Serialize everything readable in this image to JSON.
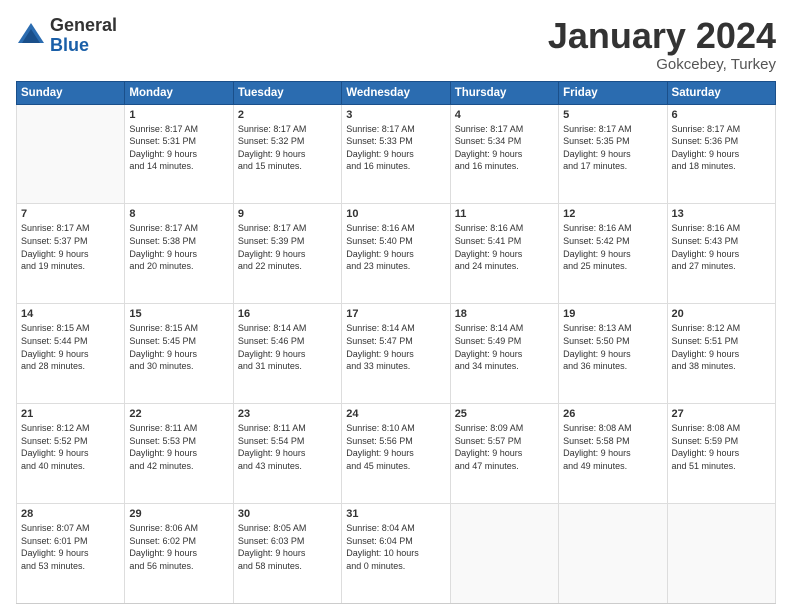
{
  "header": {
    "logo_general": "General",
    "logo_blue": "Blue",
    "month_title": "January 2024",
    "subtitle": "Gokcebey, Turkey"
  },
  "weekdays": [
    "Sunday",
    "Monday",
    "Tuesday",
    "Wednesday",
    "Thursday",
    "Friday",
    "Saturday"
  ],
  "weeks": [
    [
      {
        "day": "",
        "info": ""
      },
      {
        "day": "1",
        "info": "Sunrise: 8:17 AM\nSunset: 5:31 PM\nDaylight: 9 hours\nand 14 minutes."
      },
      {
        "day": "2",
        "info": "Sunrise: 8:17 AM\nSunset: 5:32 PM\nDaylight: 9 hours\nand 15 minutes."
      },
      {
        "day": "3",
        "info": "Sunrise: 8:17 AM\nSunset: 5:33 PM\nDaylight: 9 hours\nand 16 minutes."
      },
      {
        "day": "4",
        "info": "Sunrise: 8:17 AM\nSunset: 5:34 PM\nDaylight: 9 hours\nand 16 minutes."
      },
      {
        "day": "5",
        "info": "Sunrise: 8:17 AM\nSunset: 5:35 PM\nDaylight: 9 hours\nand 17 minutes."
      },
      {
        "day": "6",
        "info": "Sunrise: 8:17 AM\nSunset: 5:36 PM\nDaylight: 9 hours\nand 18 minutes."
      }
    ],
    [
      {
        "day": "7",
        "info": "Sunrise: 8:17 AM\nSunset: 5:37 PM\nDaylight: 9 hours\nand 19 minutes."
      },
      {
        "day": "8",
        "info": "Sunrise: 8:17 AM\nSunset: 5:38 PM\nDaylight: 9 hours\nand 20 minutes."
      },
      {
        "day": "9",
        "info": "Sunrise: 8:17 AM\nSunset: 5:39 PM\nDaylight: 9 hours\nand 22 minutes."
      },
      {
        "day": "10",
        "info": "Sunrise: 8:16 AM\nSunset: 5:40 PM\nDaylight: 9 hours\nand 23 minutes."
      },
      {
        "day": "11",
        "info": "Sunrise: 8:16 AM\nSunset: 5:41 PM\nDaylight: 9 hours\nand 24 minutes."
      },
      {
        "day": "12",
        "info": "Sunrise: 8:16 AM\nSunset: 5:42 PM\nDaylight: 9 hours\nand 25 minutes."
      },
      {
        "day": "13",
        "info": "Sunrise: 8:16 AM\nSunset: 5:43 PM\nDaylight: 9 hours\nand 27 minutes."
      }
    ],
    [
      {
        "day": "14",
        "info": "Sunrise: 8:15 AM\nSunset: 5:44 PM\nDaylight: 9 hours\nand 28 minutes."
      },
      {
        "day": "15",
        "info": "Sunrise: 8:15 AM\nSunset: 5:45 PM\nDaylight: 9 hours\nand 30 minutes."
      },
      {
        "day": "16",
        "info": "Sunrise: 8:14 AM\nSunset: 5:46 PM\nDaylight: 9 hours\nand 31 minutes."
      },
      {
        "day": "17",
        "info": "Sunrise: 8:14 AM\nSunset: 5:47 PM\nDaylight: 9 hours\nand 33 minutes."
      },
      {
        "day": "18",
        "info": "Sunrise: 8:14 AM\nSunset: 5:49 PM\nDaylight: 9 hours\nand 34 minutes."
      },
      {
        "day": "19",
        "info": "Sunrise: 8:13 AM\nSunset: 5:50 PM\nDaylight: 9 hours\nand 36 minutes."
      },
      {
        "day": "20",
        "info": "Sunrise: 8:12 AM\nSunset: 5:51 PM\nDaylight: 9 hours\nand 38 minutes."
      }
    ],
    [
      {
        "day": "21",
        "info": "Sunrise: 8:12 AM\nSunset: 5:52 PM\nDaylight: 9 hours\nand 40 minutes."
      },
      {
        "day": "22",
        "info": "Sunrise: 8:11 AM\nSunset: 5:53 PM\nDaylight: 9 hours\nand 42 minutes."
      },
      {
        "day": "23",
        "info": "Sunrise: 8:11 AM\nSunset: 5:54 PM\nDaylight: 9 hours\nand 43 minutes."
      },
      {
        "day": "24",
        "info": "Sunrise: 8:10 AM\nSunset: 5:56 PM\nDaylight: 9 hours\nand 45 minutes."
      },
      {
        "day": "25",
        "info": "Sunrise: 8:09 AM\nSunset: 5:57 PM\nDaylight: 9 hours\nand 47 minutes."
      },
      {
        "day": "26",
        "info": "Sunrise: 8:08 AM\nSunset: 5:58 PM\nDaylight: 9 hours\nand 49 minutes."
      },
      {
        "day": "27",
        "info": "Sunrise: 8:08 AM\nSunset: 5:59 PM\nDaylight: 9 hours\nand 51 minutes."
      }
    ],
    [
      {
        "day": "28",
        "info": "Sunrise: 8:07 AM\nSunset: 6:01 PM\nDaylight: 9 hours\nand 53 minutes."
      },
      {
        "day": "29",
        "info": "Sunrise: 8:06 AM\nSunset: 6:02 PM\nDaylight: 9 hours\nand 56 minutes."
      },
      {
        "day": "30",
        "info": "Sunrise: 8:05 AM\nSunset: 6:03 PM\nDaylight: 9 hours\nand 58 minutes."
      },
      {
        "day": "31",
        "info": "Sunrise: 8:04 AM\nSunset: 6:04 PM\nDaylight: 10 hours\nand 0 minutes."
      },
      {
        "day": "",
        "info": ""
      },
      {
        "day": "",
        "info": ""
      },
      {
        "day": "",
        "info": ""
      }
    ]
  ]
}
